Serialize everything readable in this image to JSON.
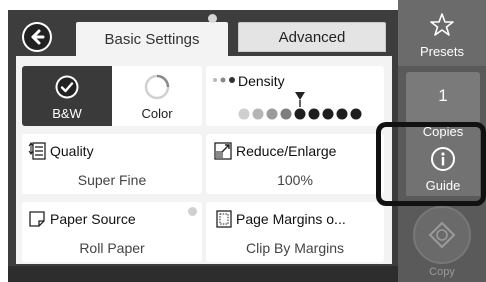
{
  "tabs": {
    "basic": "Basic Settings",
    "advanced": "Advanced"
  },
  "color_mode": {
    "bw_label": "B&W",
    "color_label": "Color",
    "selected": "B&W"
  },
  "density": {
    "title": "Density",
    "level_count": 9,
    "current_level": 4
  },
  "quality": {
    "title": "Quality",
    "value": "Super Fine"
  },
  "reduce_enlarge": {
    "title": "Reduce/Enlarge",
    "value": "100%"
  },
  "paper_source": {
    "title": "Paper Source",
    "value": "Roll Paper"
  },
  "page_margins": {
    "title": "Page Margins o...",
    "value": "Clip By Margins"
  },
  "sidebar": {
    "presets_label": "Presets",
    "copies_value": "1",
    "copies_label": "Copies",
    "guide_label": "Guide",
    "copy_label": "Copy"
  },
  "colors": {
    "panel_dark": "#3d3d3d",
    "sidebar": "#5a5a5a",
    "highlight": "#111111"
  }
}
